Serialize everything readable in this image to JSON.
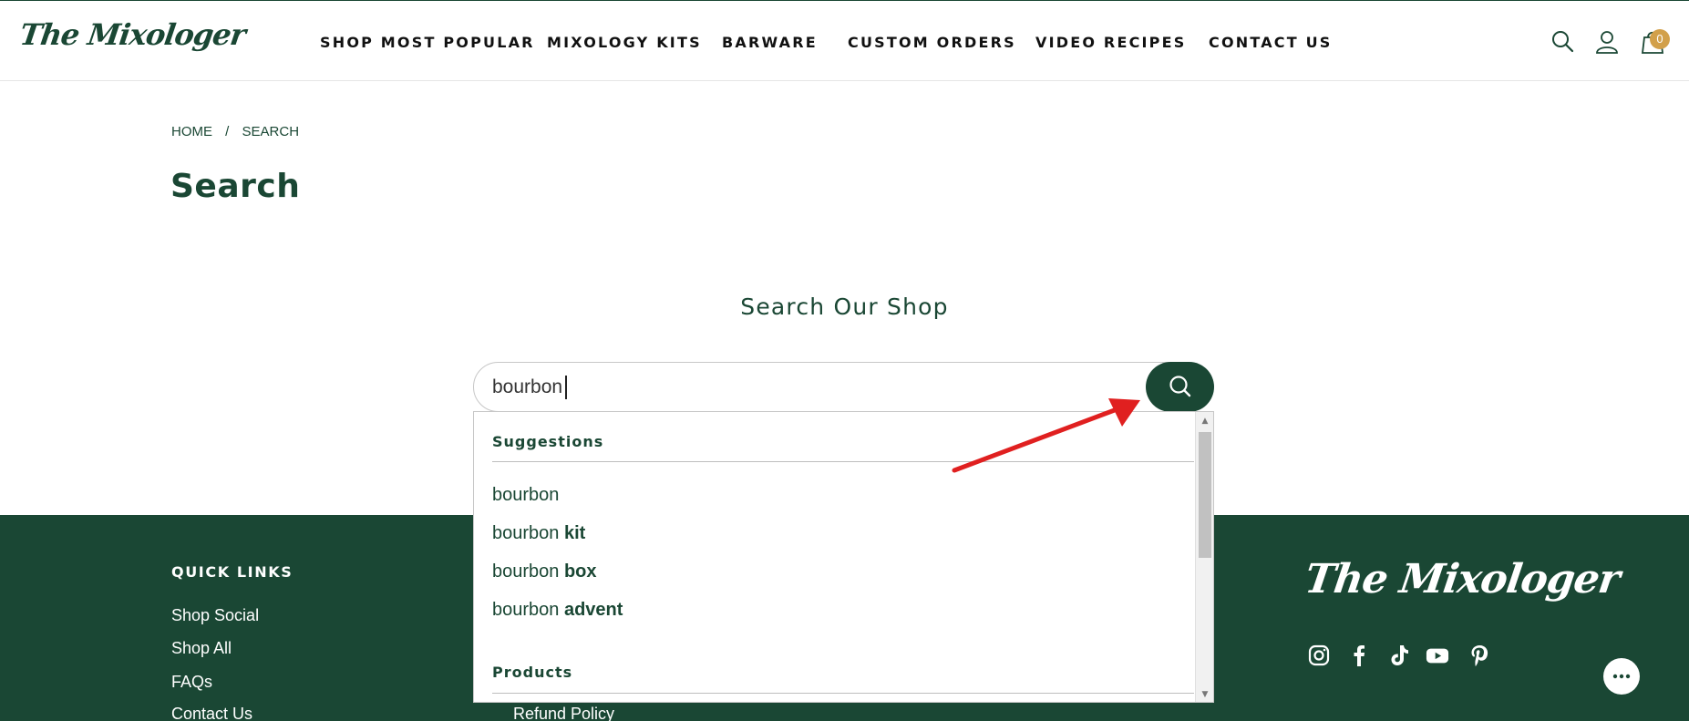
{
  "header": {
    "logo": "The Mixologer",
    "nav": [
      "SHOP MOST POPULAR",
      "MIXOLOGY KITS",
      "BARWARE",
      "CUSTOM ORDERS",
      "VIDEO RECIPES",
      "CONTACT US"
    ],
    "cart_count": "0"
  },
  "breadcrumb": {
    "home": "HOME",
    "separator": "/",
    "current": "SEARCH"
  },
  "page_title": "Search",
  "search": {
    "heading": "Search Our Shop",
    "value": "bourbon"
  },
  "dropdown": {
    "suggestions_label": "Suggestions",
    "suggestions": [
      {
        "base": "bourbon",
        "bold": ""
      },
      {
        "base": "bourbon ",
        "bold": "kit"
      },
      {
        "base": "bourbon ",
        "bold": "box"
      },
      {
        "base": "bourbon ",
        "bold": "advent"
      }
    ],
    "products_label": "Products"
  },
  "footer": {
    "quick_links_heading": "QUICK LINKS",
    "quick_links": [
      "Shop Social",
      "Shop All",
      "FAQs",
      "Contact Us"
    ],
    "other_link": "Refund Policy",
    "logo": "The Mixologer",
    "social_icons": [
      "instagram-icon",
      "facebook-icon",
      "tiktok-icon",
      "youtube-icon",
      "pinterest-icon"
    ]
  },
  "colors": {
    "brand_green": "#1a4734",
    "badge_gold": "#d2a04a",
    "annotation_red": "#e02020"
  }
}
